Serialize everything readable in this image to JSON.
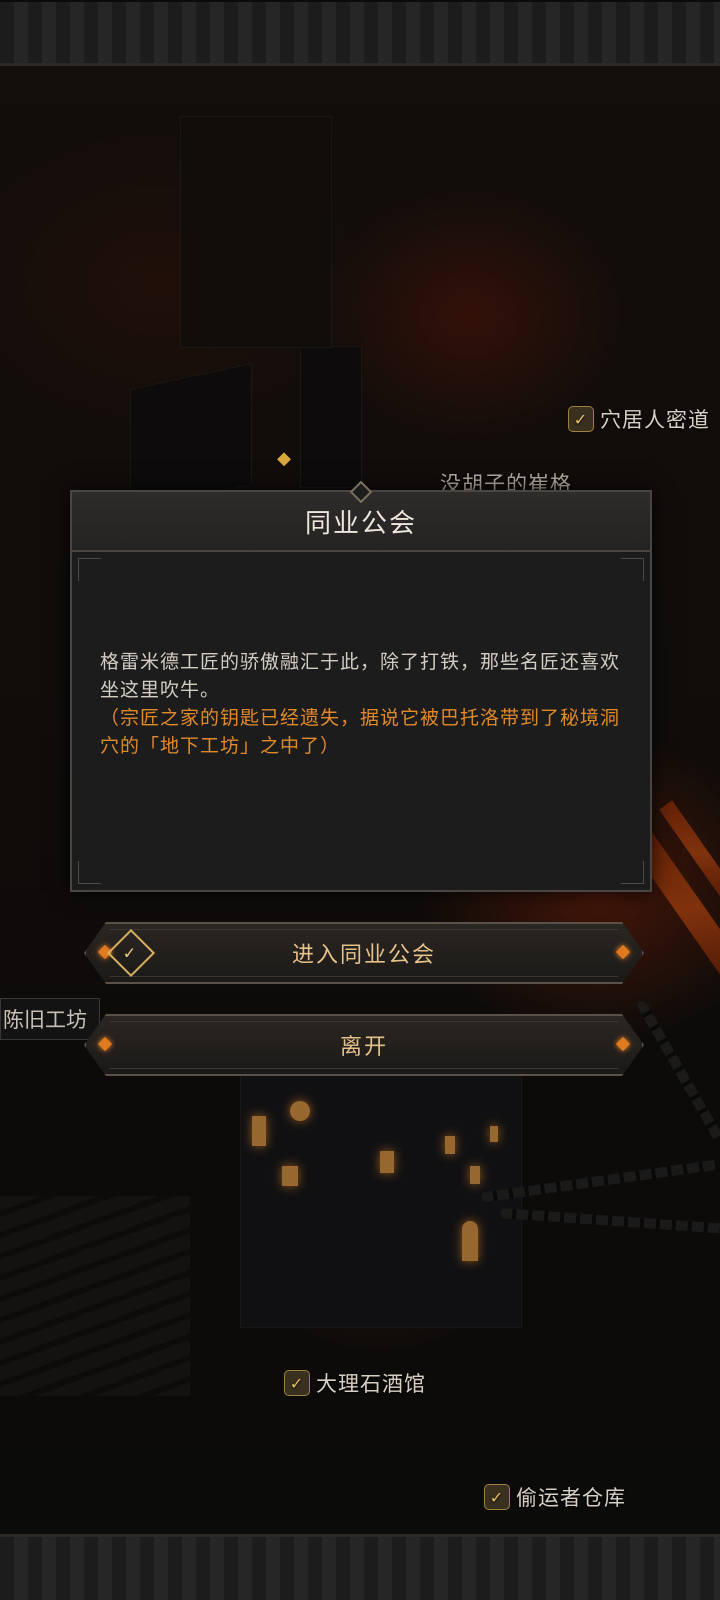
{
  "map": {
    "locations": [
      {
        "id": "cave-secret",
        "label": "穴居人密道",
        "checked": true
      },
      {
        "id": "beardless",
        "label": "没胡子的崔格",
        "checked": false
      },
      {
        "id": "old-workshop",
        "label": "陈旧工坊",
        "checked": false
      },
      {
        "id": "marble-tavern",
        "label": "大理石酒馆",
        "checked": true
      },
      {
        "id": "thief-warehouse",
        "label": "偷运者仓库",
        "checked": true
      }
    ],
    "check_icon": "check-icon"
  },
  "dialog": {
    "title": "同业公会",
    "description": "格雷米德工匠的骄傲融汇于此，除了打铁，那些名匠还喜欢坐这里吹牛。",
    "note": "（宗匠之家的钥匙已经遗失，据说它被巴托洛带到了秘境洞穴的「地下工坊」之中了）"
  },
  "buttons": {
    "enter": "进入同业公会",
    "leave": "离开"
  },
  "colors": {
    "accent": "#e6c28a",
    "note": "#e08a2a",
    "gem": "#e07a1e"
  }
}
